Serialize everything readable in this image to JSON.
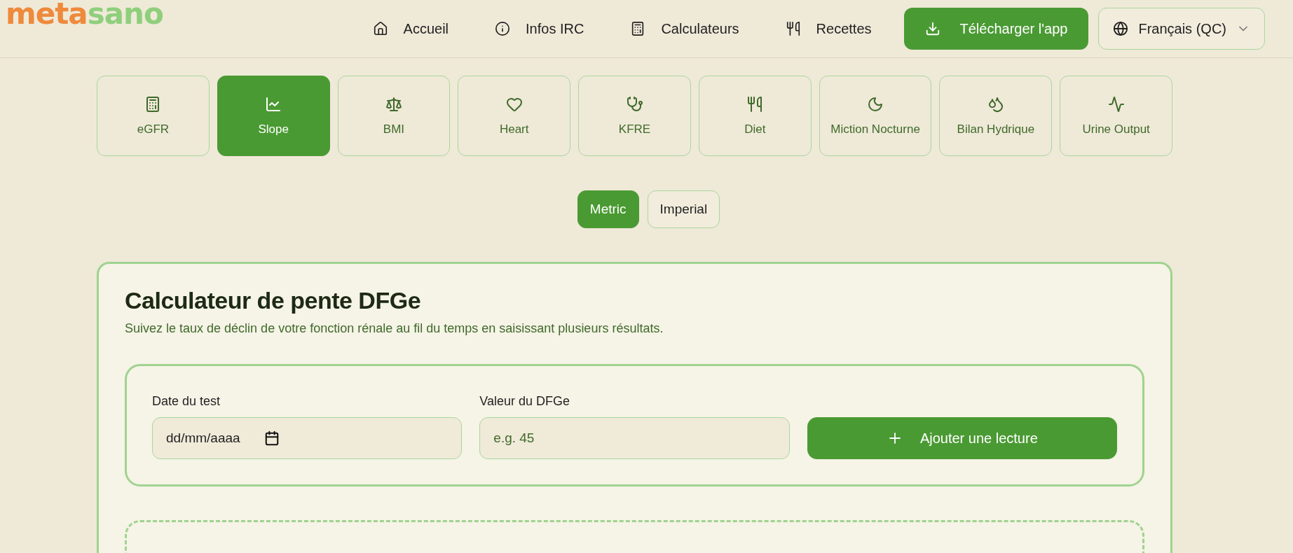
{
  "logo": {
    "part_1": "meta",
    "part_2": "sano"
  },
  "nav": [
    {
      "label": "Accueil"
    },
    {
      "label": "Infos IRC"
    },
    {
      "label": "Calculateurs"
    },
    {
      "label": "Recettes"
    }
  ],
  "download_button": "Télécharger l'app",
  "language": "Français (QC)",
  "calculator_tabs": [
    {
      "label": "eGFR",
      "selected": false
    },
    {
      "label": "Slope",
      "selected": true
    },
    {
      "label": "BMI",
      "selected": false
    },
    {
      "label": "Heart",
      "selected": false
    },
    {
      "label": "KFRE",
      "selected": false
    },
    {
      "label": "Diet",
      "selected": false
    },
    {
      "label": "Miction Nocturne",
      "selected": false
    },
    {
      "label": "Bilan Hydrique",
      "selected": false
    },
    {
      "label": "Urine Output",
      "selected": false
    }
  ],
  "units": [
    {
      "label": "Metric",
      "selected": true
    },
    {
      "label": "Imperial",
      "selected": false
    }
  ],
  "card": {
    "title": "Calculateur de pente DFGe",
    "subtitle": "Suivez le taux de déclin de votre fonction rénale au fil du temps en saisissant plusieurs résultats.",
    "date_label": "Date du test",
    "date_placeholder": "dd/mm/aaaa",
    "value_label": "Valeur du DFGe",
    "value_placeholder": "e.g. 45",
    "add_button": "Ajouter une lecture"
  }
}
